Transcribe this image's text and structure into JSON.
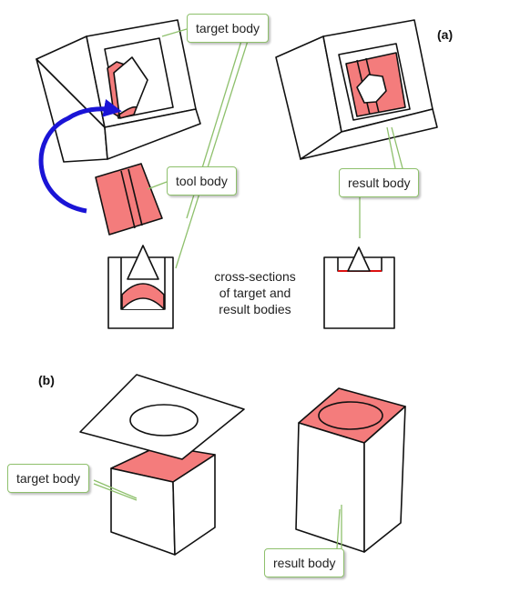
{
  "panels": {
    "a": "(a)",
    "b": "(b)"
  },
  "callouts": {
    "target_body_a": "target body",
    "tool_body": "tool body",
    "result_body_a": "result body",
    "target_body_b": "target body",
    "result_body_b": "result body"
  },
  "caption": {
    "line1": "cross-sections",
    "line2": "of target and",
    "line3": "result bodies"
  },
  "colors": {
    "fill": "#f47c7c",
    "stroke": "#111111",
    "arrow": "#1a14d6",
    "leader": "#8ec06c"
  }
}
